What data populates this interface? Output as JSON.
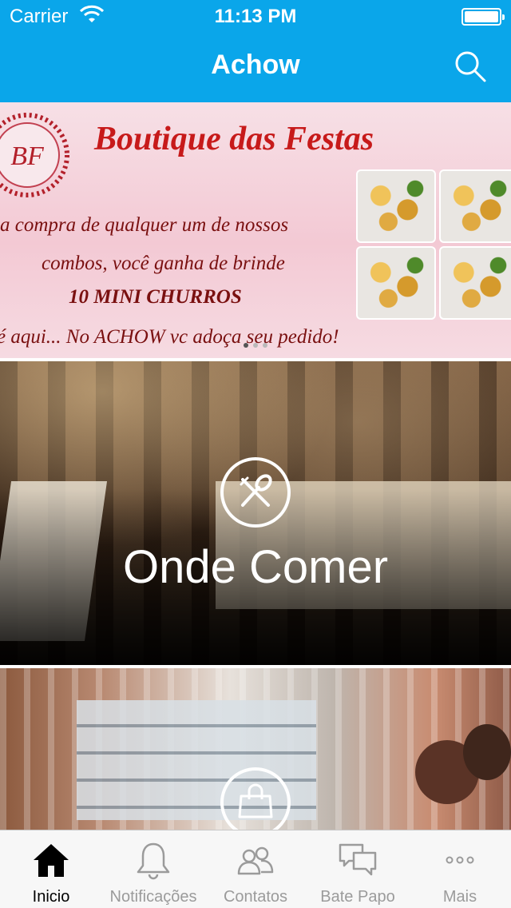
{
  "status_bar": {
    "carrier": "Carrier",
    "time": "11:13 PM"
  },
  "nav_bar": {
    "title": "Achow"
  },
  "banner": {
    "monogram": "BF",
    "headline": "Boutique das Festas",
    "lines": [
      "a compra de qualquer um de nossos",
      "combos, você ganha de brinde",
      "10 MINI CHURROS",
      "é aqui... No ACHOW vc adoça seu pedido!"
    ]
  },
  "categories": [
    {
      "label": "Onde Comer",
      "icon": "utensils-icon"
    },
    {
      "label": "",
      "icon": "shopping-bag-icon"
    }
  ],
  "tab_bar": {
    "items": [
      {
        "label": "Inicio",
        "icon": "home-icon",
        "active": true
      },
      {
        "label": "Notificações",
        "icon": "bell-icon",
        "active": false
      },
      {
        "label": "Contatos",
        "icon": "contacts-icon",
        "active": false
      },
      {
        "label": "Bate Papo",
        "icon": "chat-icon",
        "active": false
      },
      {
        "label": "Mais",
        "icon": "more-icon",
        "active": false
      }
    ]
  },
  "colors": {
    "brand": "#0aa6ea",
    "tab_active": "#000000",
    "tab_inactive": "#9b9b9b"
  }
}
